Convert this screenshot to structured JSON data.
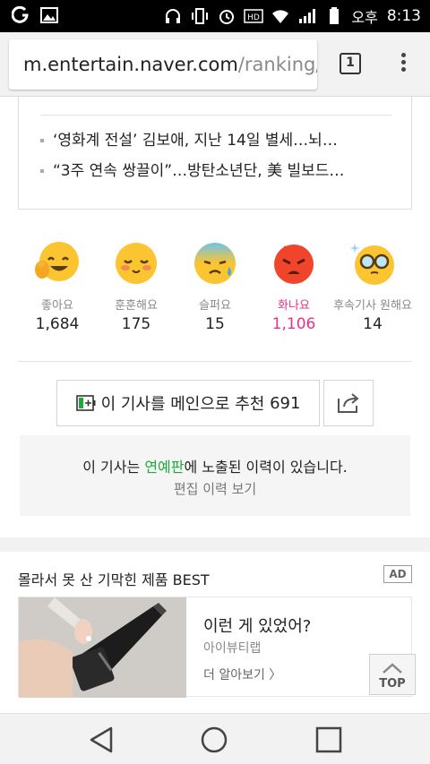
{
  "status_bar": {
    "time": "8:13",
    "ampm": "오후",
    "icons": [
      "o-app-icon",
      "image-icon",
      "headset-icon",
      "vibrate-icon",
      "alarm-icon",
      "hd-icon",
      "wifi-icon",
      "signal-icon",
      "battery-icon"
    ]
  },
  "browser": {
    "url_host": "m.entertain.naver.com",
    "url_path": "/ranking/re",
    "tab_count": "1"
  },
  "related_news": [
    "‘영화계 전설’ 김보애, 지난 14일 별세…뇌…",
    "“3주 연속 쌍끌이”…방탄소년단, 美 빌보드…"
  ],
  "reactions": [
    {
      "label": "좋아요",
      "count": "1,684",
      "icon": "thumbs-up-face-icon",
      "active": false
    },
    {
      "label": "훈훈해요",
      "count": "175",
      "icon": "blushing-face-icon",
      "active": false
    },
    {
      "label": "슬퍼요",
      "count": "15",
      "icon": "sad-face-icon",
      "active": false
    },
    {
      "label": "화나요",
      "count": "1,106",
      "icon": "angry-face-icon",
      "active": true
    },
    {
      "label": "후속기사 원해요",
      "count": "14",
      "icon": "glasses-face-icon",
      "active": false
    }
  ],
  "recommend": {
    "label": "이 기사를 메인으로 추천",
    "count": "691"
  },
  "notice": {
    "text_before": "이 기사는 ",
    "highlight": "연예판",
    "text_after": "에 노출된 이력이 있습니다.",
    "link": "편집 이력 보기"
  },
  "ad": {
    "section_title": "몰라서 못 산 기막힌 제품 BEST",
    "badge": "AD",
    "headline": "이런 게 있었어?",
    "brand": "아이뷰티랩",
    "more": "더 알아보기 〉"
  },
  "top_button": "TOP",
  "colors": {
    "accent_pink": "#e8318a",
    "accent_green": "#1ea93c",
    "emoji_yellow": "#fbc531"
  }
}
